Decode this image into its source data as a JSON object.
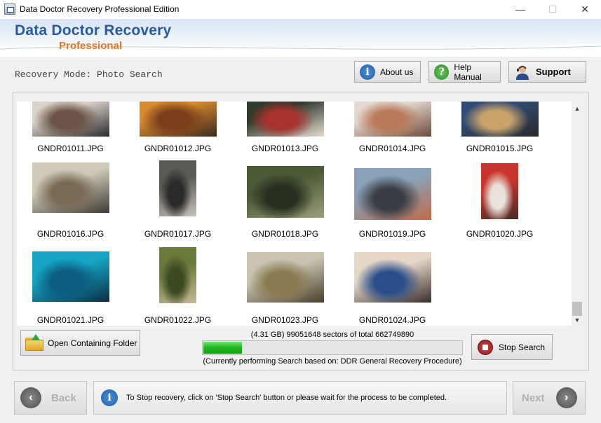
{
  "window": {
    "title": "Data Doctor Recovery Professional Edition",
    "minimize_glyph": "—",
    "maximize_glyph": "☐",
    "close_glyph": "✕"
  },
  "header": {
    "brand_line1": "Data Doctor Recovery",
    "brand_line2": "Professional",
    "mode_label": "Recovery Mode:  Photo Search",
    "buttons": {
      "about": {
        "label": "About us",
        "icon": "info-icon",
        "color": "#1f5fa8"
      },
      "help": {
        "label": "Help Manual",
        "icon": "question-icon",
        "color": "#3a9a2e"
      },
      "support": {
        "label": "Support",
        "icon": "support-person-icon"
      }
    }
  },
  "photos": [
    {
      "name": "GNDR01011.JPG",
      "colors": [
        "#d9d2c8",
        "#6b5447",
        "#2c2a2e"
      ]
    },
    {
      "name": "GNDR01012.JPG",
      "colors": [
        "#d88a2e",
        "#7a3e1b",
        "#3a2a1e"
      ]
    },
    {
      "name": "GNDR01013.JPG",
      "colors": [
        "#2f3a2a",
        "#a8322e",
        "#e6dcd2"
      ]
    },
    {
      "name": "GNDR01014.JPG",
      "colors": [
        "#e4d8d0",
        "#b87a5a",
        "#6c4a3a"
      ]
    },
    {
      "name": "GNDR01015.JPG",
      "colors": [
        "#2f4b76",
        "#c9a36a",
        "#2a2a2a"
      ]
    },
    {
      "name": "GNDR01016.JPG",
      "colors": [
        "#cfcab9",
        "#7a6a55",
        "#3c3a34"
      ]
    },
    {
      "name": "GNDR01017.JPG",
      "colors": [
        "#5b5954",
        "#2a2a2a",
        "#c8c2bb"
      ]
    },
    {
      "name": "GNDR01018.JPG",
      "colors": [
        "#4d5a38",
        "#273020",
        "#9aa07a"
      ]
    },
    {
      "name": "GNDR01019.JPG",
      "colors": [
        "#8aa2b8",
        "#3a3e44",
        "#c06a4a"
      ]
    },
    {
      "name": "GNDR01020.JPG",
      "colors": [
        "#c8352e",
        "#e8e2da",
        "#4a2a26"
      ]
    },
    {
      "name": "GNDR01021.JPG",
      "colors": [
        "#16a5c4",
        "#0c5d80",
        "#0a2e44"
      ]
    },
    {
      "name": "GNDR01022.JPG",
      "colors": [
        "#6a7a3a",
        "#3b4a22",
        "#c8b898"
      ]
    },
    {
      "name": "GNDR01023.JPG",
      "colors": [
        "#c8c4b0",
        "#8a7a52",
        "#4a3e2a"
      ]
    },
    {
      "name": "GNDR01024.JPG",
      "colors": [
        "#e6d8c8",
        "#2a4e8a",
        "#3a2e2a"
      ]
    }
  ],
  "buttons": {
    "open_folder": "Open Containing Folder",
    "stop_search": "Stop Search",
    "back": "Back",
    "next": "Next"
  },
  "progress": {
    "sectors_text": "(4.31 GB) 99051648  sectors  of  total 662749890",
    "fraction": 0.149,
    "status_text": "(Currently performing Search based on:  DDR General Recovery Procedure)"
  },
  "info_message": "To Stop recovery, click on 'Stop Search' button or please wait for the process to be completed."
}
